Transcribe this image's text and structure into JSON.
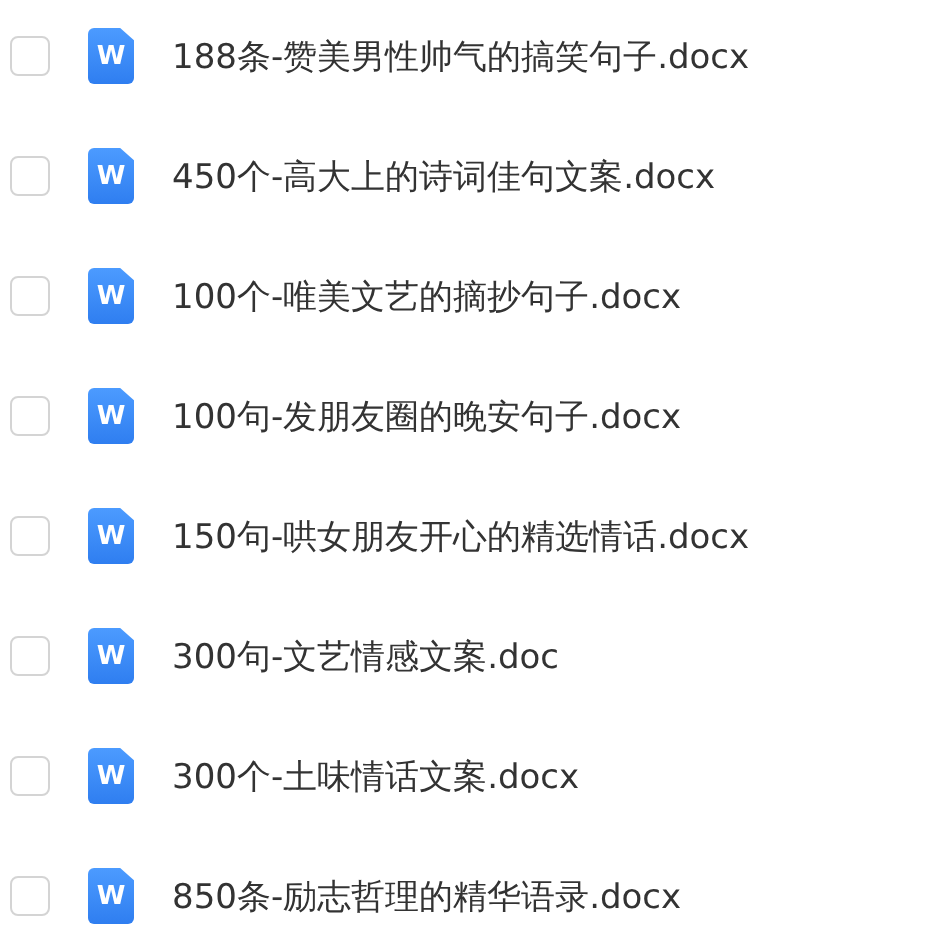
{
  "files": [
    {
      "name": "188条-赞美男性帅气的搞笑句子.docx",
      "icon_letter": "W",
      "checked": false
    },
    {
      "name": "450个-高大上的诗词佳句文案.docx",
      "icon_letter": "W",
      "checked": false
    },
    {
      "name": "100个-唯美文艺的摘抄句子.docx",
      "icon_letter": "W",
      "checked": false
    },
    {
      "name": "100句-发朋友圈的晚安句子.docx",
      "icon_letter": "W",
      "checked": false
    },
    {
      "name": "150句-哄女朋友开心的精选情话.docx",
      "icon_letter": "W",
      "checked": false
    },
    {
      "name": "300句-文艺情感文案.doc",
      "icon_letter": "W",
      "checked": false
    },
    {
      "name": "300个-土味情话文案.docx",
      "icon_letter": "W",
      "checked": false
    },
    {
      "name": "850条-励志哲理的精华语录.docx",
      "icon_letter": "W",
      "checked": false
    }
  ]
}
